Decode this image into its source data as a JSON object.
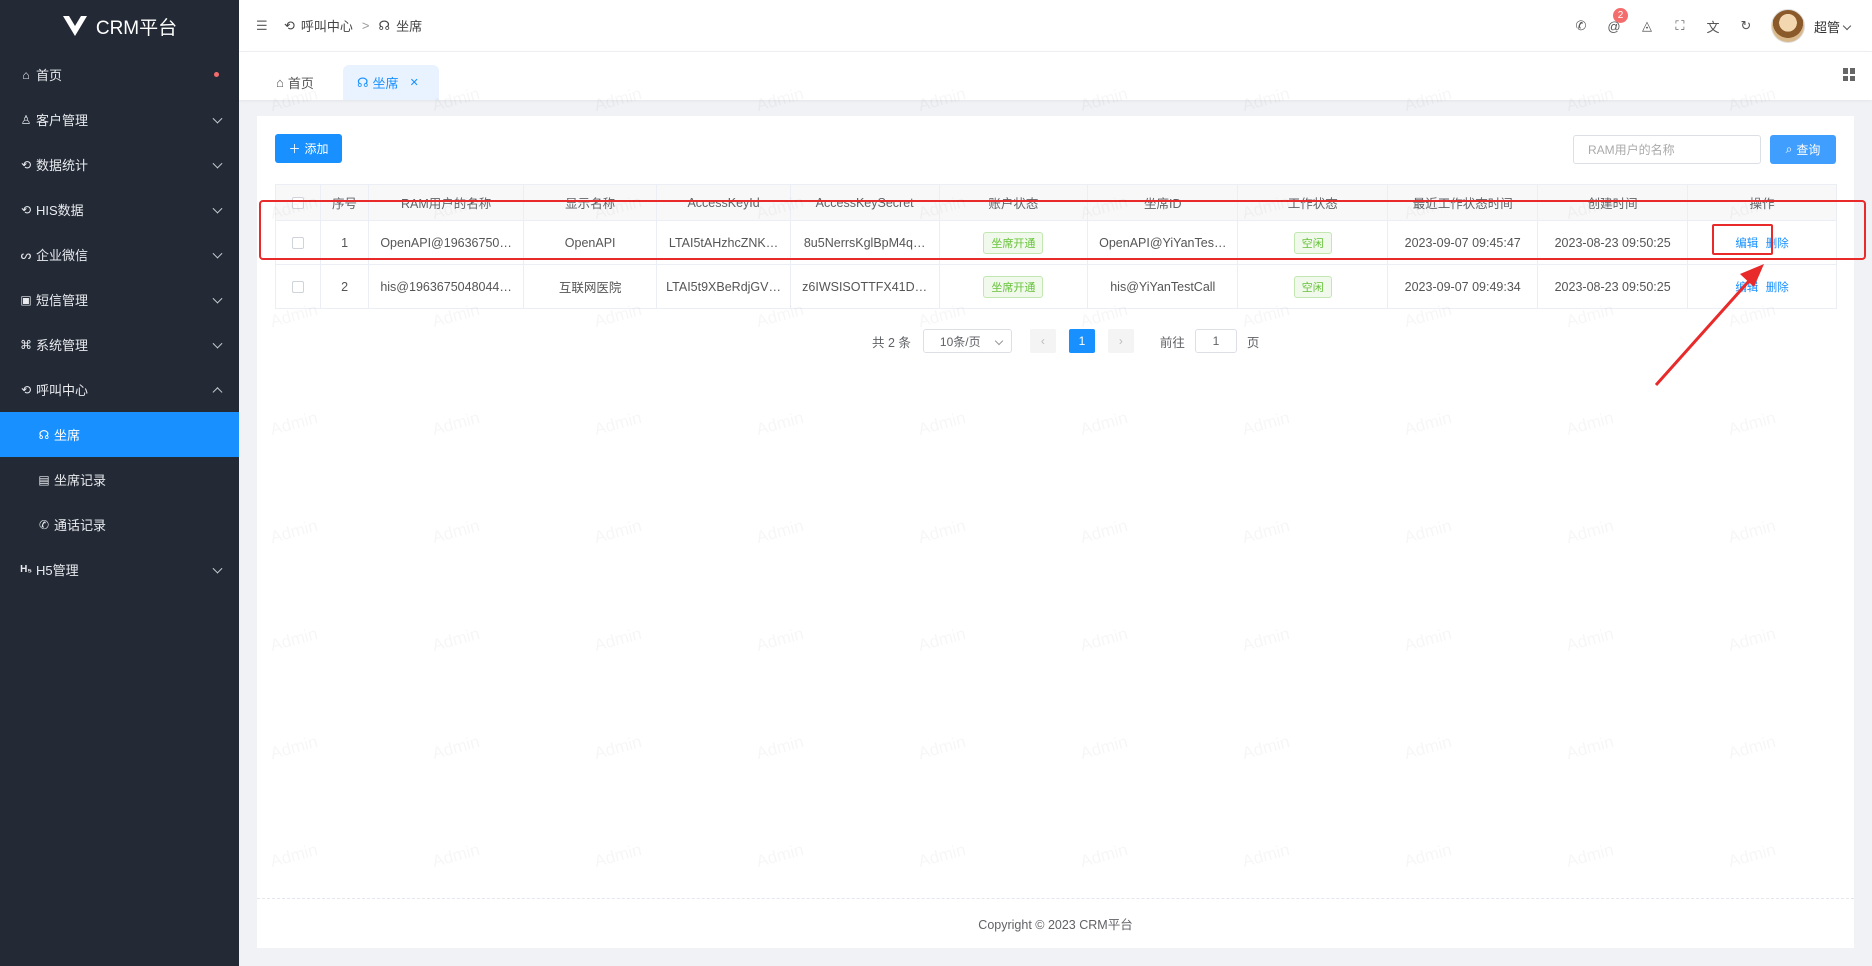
{
  "app": {
    "title": "CRM平台"
  },
  "sidebar": {
    "items": [
      {
        "label": "首页",
        "icon": "home-icon",
        "has_dot": true
      },
      {
        "label": "客户管理",
        "icon": "user-icon"
      },
      {
        "label": "数据统计",
        "icon": "chart-icon"
      },
      {
        "label": "HIS数据",
        "icon": "data-icon"
      },
      {
        "label": "企业微信",
        "icon": "wechat-icon"
      },
      {
        "label": "短信管理",
        "icon": "message-icon"
      },
      {
        "label": "系统管理",
        "icon": "command-icon"
      },
      {
        "label": "呼叫中心",
        "icon": "call-center-icon",
        "expanded": true
      },
      {
        "label": "坐席",
        "icon": "headset-icon",
        "active": true
      },
      {
        "label": "坐席记录",
        "icon": "clipboard-icon"
      },
      {
        "label": "通话记录",
        "icon": "phone-icon"
      },
      {
        "label": "H5管理",
        "icon": "h5-icon"
      }
    ]
  },
  "header": {
    "breadcrumb": [
      "呼叫中心",
      "坐席"
    ],
    "breadcrumb_sep": ">",
    "notification_count": "2",
    "user_name": "超管"
  },
  "tabs": [
    {
      "label": "首页",
      "active": false
    },
    {
      "label": "坐席",
      "active": true
    }
  ],
  "toolbar": {
    "add_label": "添加",
    "search_placeholder": "RAM用户的名称",
    "query_label": "查询"
  },
  "table": {
    "columns": [
      "序号",
      "RAM用户的名称",
      "显示名称",
      "AccessKeyId",
      "AccessKeySecret",
      "账户状态",
      "坐席ID",
      "工作状态",
      "最近工作状态时间",
      "创建时间",
      "操作"
    ],
    "rows": [
      {
        "index": "1",
        "ram_user": "OpenAPI@19636750…",
        "display_name": "OpenAPI",
        "access_key_id": "LTAI5tAHzhcZNK…",
        "access_key_secret": "8u5NerrsKglBpM4q…",
        "account_status": "坐席开通",
        "seat_id": "OpenAPI@YiYanTes…",
        "work_status": "空闲",
        "last_work_time": "2023-09-07 09:45:47",
        "created_at": "2023-08-23 09:50:25",
        "edit": "编辑",
        "delete": "删除"
      },
      {
        "index": "2",
        "ram_user": "his@1963675048044…",
        "display_name": "互联网医院",
        "access_key_id": "LTAI5t9XBeRdjGV…",
        "access_key_secret": "z6IWSISOTTFX41D…",
        "account_status": "坐席开通",
        "seat_id": "his@YiYanTestCall",
        "work_status": "空闲",
        "last_work_time": "2023-09-07 09:49:34",
        "created_at": "2023-08-23 09:50:25",
        "edit": "编辑",
        "delete": "删除"
      }
    ]
  },
  "pagination": {
    "total_label": "共 2 条",
    "page_size": "10条/页",
    "current_page": "1",
    "goto_label": "前往",
    "goto_value": "1",
    "page_suffix": "页"
  },
  "footer": {
    "copyright": "Copyright ©  2023 CRM平台"
  },
  "watermark": "Admin",
  "colors": {
    "sidebar_bg": "#232a36",
    "accent": "#1890ff",
    "annotation": "#e82a2a",
    "success": "#67c23a"
  }
}
